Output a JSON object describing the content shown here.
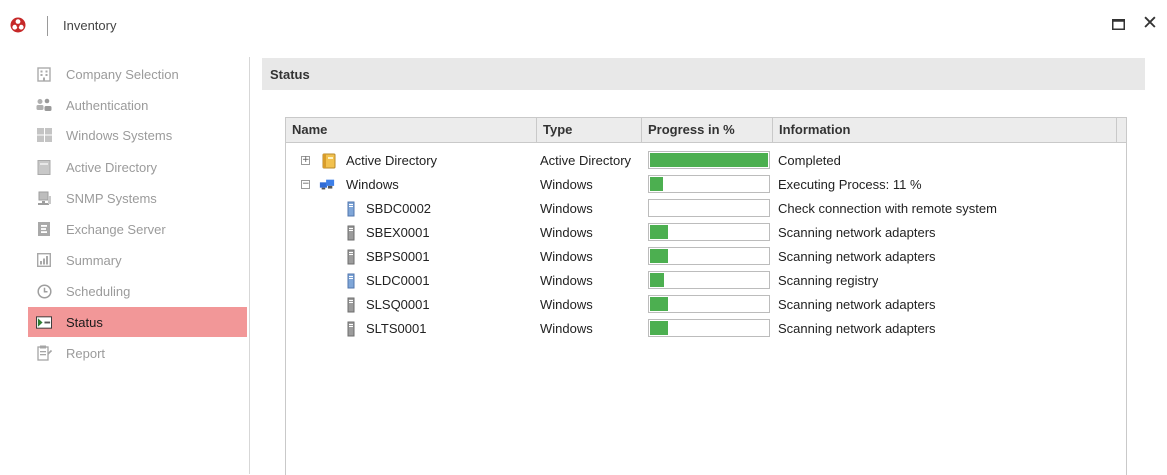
{
  "window": {
    "title": "Inventory",
    "maximize_icon": "maximize-icon",
    "close_glyph": "✕"
  },
  "sidebar": {
    "items": [
      {
        "label": "Company Selection",
        "icon": "building-icon",
        "active": false
      },
      {
        "label": "Authentication",
        "icon": "users-key-icon",
        "active": false
      },
      {
        "label": "Windows Systems",
        "icon": "windows-icon",
        "active": false
      },
      {
        "label": "Active Directory",
        "icon": "directory-book-icon",
        "active": false
      },
      {
        "label": "SNMP Systems",
        "icon": "network-device-icon",
        "active": false
      },
      {
        "label": "Exchange Server",
        "icon": "exchange-icon",
        "active": false
      },
      {
        "label": "Summary",
        "icon": "summary-icon",
        "active": false
      },
      {
        "label": "Scheduling",
        "icon": "clock-icon",
        "active": false
      },
      {
        "label": "Status",
        "icon": "status-flag-icon",
        "active": true
      },
      {
        "label": "Report",
        "icon": "report-icon",
        "active": false
      }
    ]
  },
  "main": {
    "section_title": "Status",
    "grid": {
      "columns": [
        "Name",
        "Type",
        "Progress in %",
        "Information"
      ],
      "rows": [
        {
          "name": "Active Directory",
          "type": "Active Directory",
          "progress": 100,
          "info": "Completed",
          "level": 0,
          "expander": "+",
          "icon": "directory-book-icon"
        },
        {
          "name": "Windows",
          "type": "Windows",
          "progress": 11,
          "info": "Executing Process: 11 %",
          "level": 0,
          "expander": "−",
          "icon": "windows-computers-icon"
        },
        {
          "name": "SBDC0002",
          "type": "Windows",
          "progress": 0,
          "info": "Check connection with remote system",
          "level": 1,
          "icon": "domain-controller-icon"
        },
        {
          "name": "SBEX0001",
          "type": "Windows",
          "progress": 15,
          "info": "Scanning network adapters",
          "level": 1,
          "icon": "server-icon"
        },
        {
          "name": "SBPS0001",
          "type": "Windows",
          "progress": 15,
          "info": "Scanning network adapters",
          "level": 1,
          "icon": "server-icon"
        },
        {
          "name": "SLDC0001",
          "type": "Windows",
          "progress": 12,
          "info": "Scanning registry",
          "level": 1,
          "icon": "domain-controller-icon"
        },
        {
          "name": "SLSQ0001",
          "type": "Windows",
          "progress": 15,
          "info": "Scanning network adapters",
          "level": 1,
          "icon": "server-icon"
        },
        {
          "name": "SLTS0001",
          "type": "Windows",
          "progress": 15,
          "info": "Scanning network adapters",
          "level": 1,
          "icon": "server-icon"
        }
      ]
    }
  },
  "colors": {
    "active_nav": "#f29798",
    "progress_fill": "#4caf50",
    "header_bg": "#e8e8e8"
  }
}
